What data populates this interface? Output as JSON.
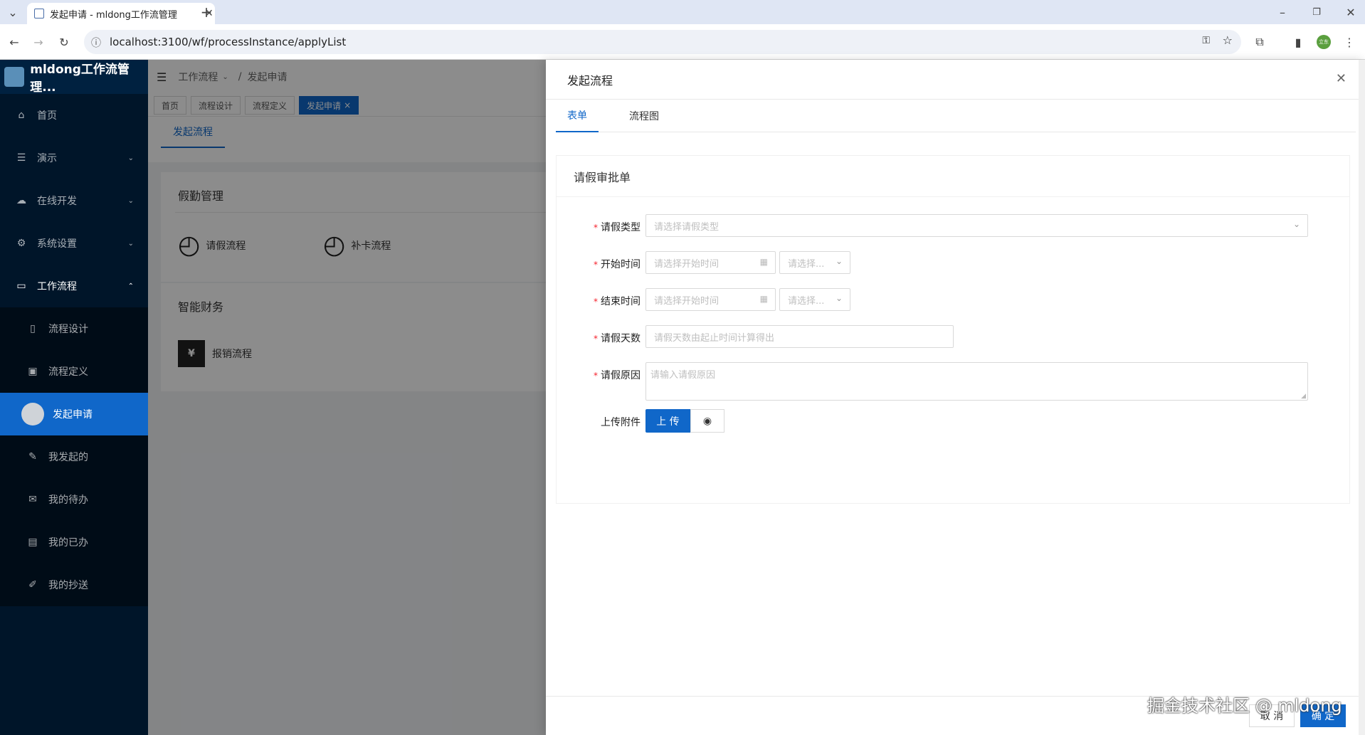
{
  "browser": {
    "tab_title": "发起申请 - mldong工作流管理",
    "url": "localhost:3100/wf/processInstance/applyList",
    "profile_badge": "立东"
  },
  "sidebar": {
    "app_title": "mldong工作流管理...",
    "items": [
      {
        "label": "首页",
        "icon": "home-icon"
      },
      {
        "label": "演示",
        "icon": "list-icon"
      },
      {
        "label": "在线开发",
        "icon": "cloud-icon"
      },
      {
        "label": "系统设置",
        "icon": "gear-icon"
      },
      {
        "label": "工作流程",
        "icon": "desktop-icon"
      }
    ],
    "sub_items": [
      {
        "label": "流程设计"
      },
      {
        "label": "流程定义"
      },
      {
        "label": "发起申请"
      },
      {
        "label": "我发起的"
      },
      {
        "label": "我的待办"
      },
      {
        "label": "我的已办"
      },
      {
        "label": "我的抄送"
      }
    ]
  },
  "main": {
    "breadcrumb_parent": "工作流程",
    "breadcrumb_current": "发起申请",
    "view_tabs": [
      "首页",
      "流程设计",
      "流程定义",
      "发起申请"
    ],
    "page_tab": "发起流程",
    "group1_title": "假勤管理",
    "group1_items": [
      "请假流程",
      "补卡流程"
    ],
    "group2_title": "智能财务",
    "group2_items": [
      "报销流程"
    ]
  },
  "drawer": {
    "title": "发起流程",
    "tabs": [
      "表单",
      "流程图"
    ],
    "form_title": "请假审批单",
    "fields": {
      "leave_type_label": "请假类型",
      "leave_type_placeholder": "请选择请假类型",
      "start_label": "开始时间",
      "start_placeholder": "请选择开始时间",
      "start_period": "请选择...",
      "end_label": "结束时间",
      "end_placeholder": "请选择开始时间",
      "end_period": "请选择...",
      "days_label": "请假天数",
      "days_placeholder": "请假天数由起止时间计算得出",
      "reason_label": "请假原因",
      "reason_placeholder": "请输入请假原因",
      "upload_label": "上传附件",
      "upload_button": "上 传"
    },
    "cancel_button": "取 消",
    "ok_button": "确 定"
  },
  "watermark": "掘金技术社区 @ mldong"
}
